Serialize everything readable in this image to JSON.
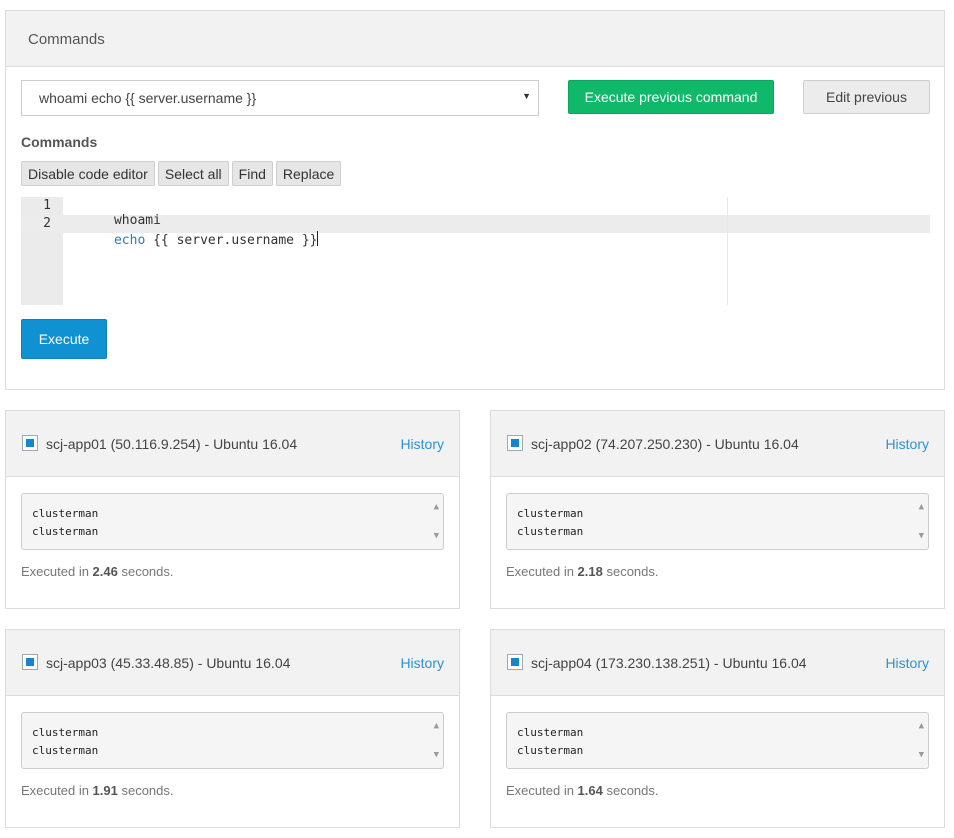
{
  "commands_panel": {
    "title": "Commands",
    "select_value": "whoami echo {{ server.username }}",
    "execute_previous_label": "Execute previous command",
    "edit_previous_label": "Edit previous",
    "section_label": "Commands",
    "toolbar": {
      "disable_editor": "Disable code editor",
      "select_all": "Select all",
      "find": "Find",
      "replace": "Replace"
    },
    "editor": {
      "lines": [
        {
          "number": "1",
          "text": "whoami"
        },
        {
          "number": "2",
          "keyword": "echo",
          "text": " {{ server.username }}"
        }
      ]
    },
    "execute_label": "Execute"
  },
  "servers": [
    {
      "name": "scj-app01 (50.116.9.254) - Ubuntu 16.04",
      "history_label": "History",
      "output": [
        "clusterman",
        "clusterman"
      ],
      "executed_prefix": "Executed in ",
      "seconds": "2.46",
      "executed_suffix": " seconds."
    },
    {
      "name": "scj-app02 (74.207.250.230) - Ubuntu 16.04",
      "history_label": "History",
      "output": [
        "clusterman",
        "clusterman"
      ],
      "executed_prefix": "Executed in ",
      "seconds": "2.18",
      "executed_suffix": " seconds."
    },
    {
      "name": "scj-app03 (45.33.48.85) - Ubuntu 16.04",
      "history_label": "History",
      "output": [
        "clusterman",
        "clusterman"
      ],
      "executed_prefix": "Executed in ",
      "seconds": "1.91",
      "executed_suffix": " seconds."
    },
    {
      "name": "scj-app04 (173.230.138.251) - Ubuntu 16.04",
      "history_label": "History",
      "output": [
        "clusterman",
        "clusterman"
      ],
      "executed_prefix": "Executed in ",
      "seconds": "1.64",
      "executed_suffix": " seconds."
    }
  ],
  "icons": {
    "select_arrow": "caret-down-icon",
    "checkbox": "checkbox-checked-icon",
    "scroll_up": "scroll-up-arrow-icon",
    "scroll_down": "scroll-down-arrow-icon"
  },
  "colors": {
    "primary": "#0f91d2",
    "success": "#10b86a",
    "link": "#2a93d6",
    "checkbox": "#1087d0"
  }
}
